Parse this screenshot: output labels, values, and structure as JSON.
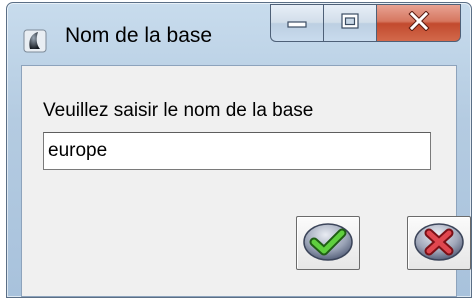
{
  "window": {
    "title": "Nom de la base",
    "icon": "app-icon"
  },
  "caption_buttons": {
    "minimize": "minimize-icon",
    "maximize": "maximize-icon",
    "close": "close-icon"
  },
  "dialog": {
    "prompt": "Veuillez saisir le nom de la base",
    "input_value": "europe"
  },
  "buttons": {
    "ok_icon": "checkmark-icon",
    "cancel_icon": "cancel-x-icon"
  },
  "colors": {
    "ok_accent": "#3fa02c",
    "cancel_accent": "#c8323b",
    "close_button": "#c24a2e"
  }
}
